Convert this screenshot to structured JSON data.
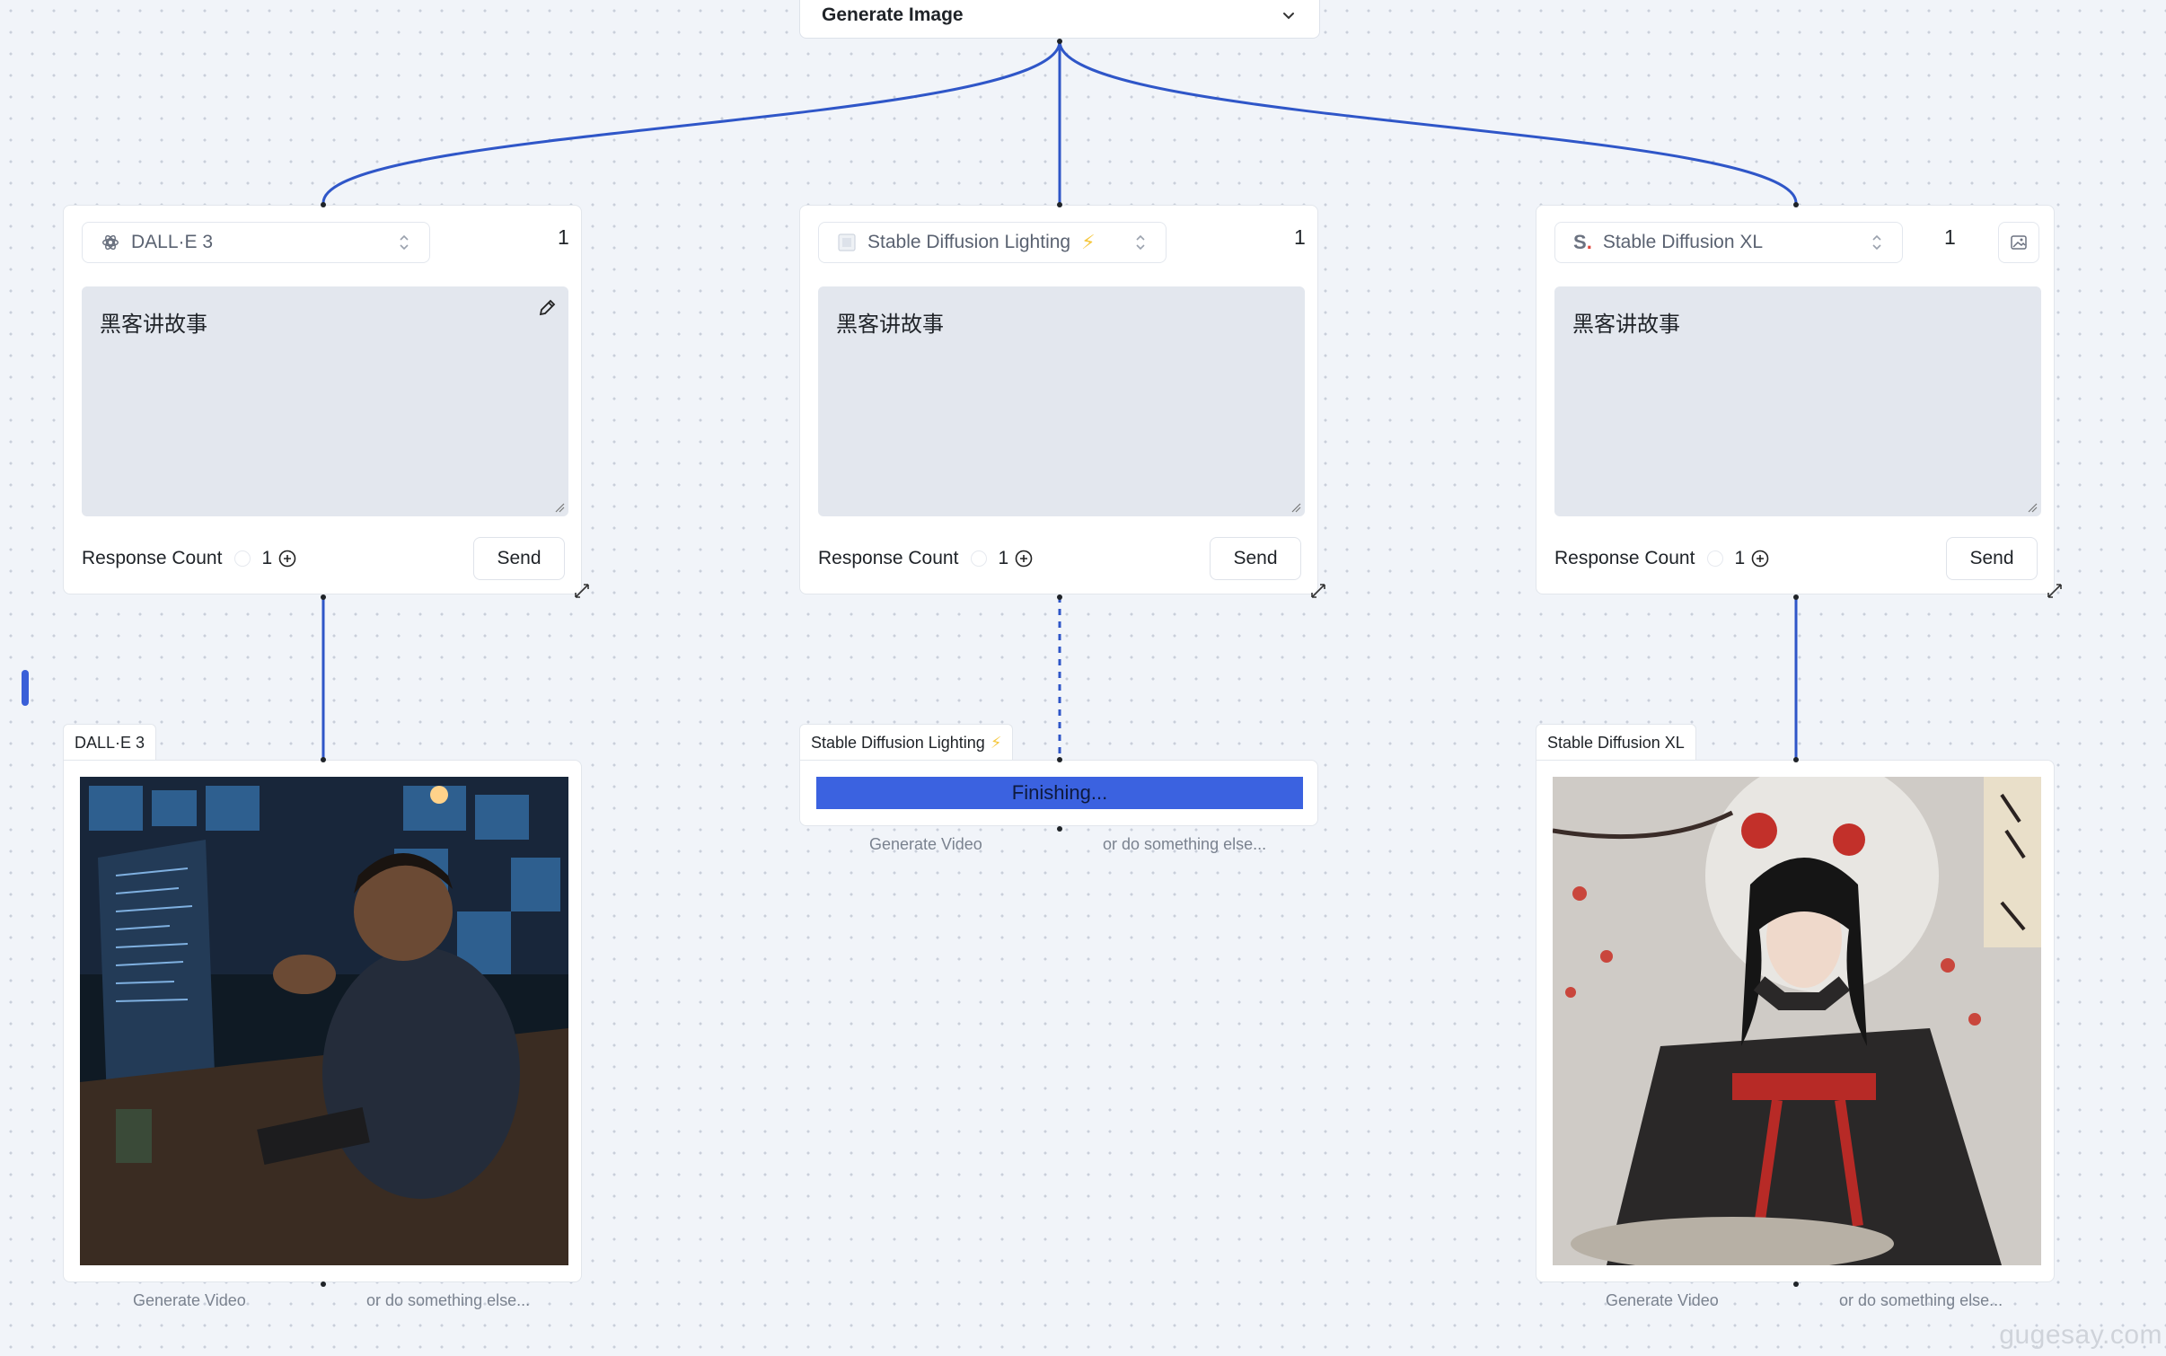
{
  "header_node": {
    "title": "Generate Image"
  },
  "cards": [
    {
      "model": "DALL·E 3",
      "count": "1",
      "prompt": "黑客讲故事",
      "response_label": "Response Count",
      "response_value": "1",
      "send": "Send"
    },
    {
      "model": "Stable Diffusion Lighting",
      "count": "1",
      "prompt": "黑客讲故事",
      "response_label": "Response Count",
      "response_value": "1",
      "send": "Send"
    },
    {
      "model": "Stable Diffusion XL",
      "count": "1",
      "prompt": "黑客讲故事",
      "response_label": "Response Count",
      "response_value": "1",
      "send": "Send"
    }
  ],
  "results": [
    {
      "label": "DALL·E 3",
      "state": "image",
      "generate_video": "Generate Video",
      "other": "or do something else..."
    },
    {
      "label": "Stable Diffusion Lighting",
      "state": "progress",
      "progress_text": "Finishing...",
      "generate_video": "Generate Video",
      "other": "or do something else..."
    },
    {
      "label": "Stable Diffusion XL",
      "state": "image",
      "generate_video": "Generate Video",
      "other": "or do something else..."
    }
  ],
  "watermark": "gugesay.com",
  "colors": {
    "accent": "#3a5fd8",
    "edge": "#2f56c8",
    "lightning": "#f5c842"
  }
}
